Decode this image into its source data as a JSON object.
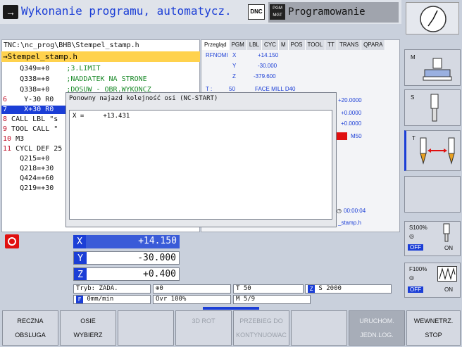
{
  "header": {
    "mode_title": "Wykonanie programu, automatycz.",
    "dnc_icon": "DNC",
    "pgm_icon_line1": "PGM",
    "pgm_icon_line2": "MGT",
    "programming_label": "Programowanie"
  },
  "program": {
    "path": "TNC:\\nc_prog\\BHB\\Stempel_stamp.h",
    "file": "→Stempel_stamp.h",
    "lines": [
      {
        "num": "",
        "code": "    Q349=+0",
        "comment": "    ;3.LIMIT"
      },
      {
        "num": "",
        "code": "    Q338=+0",
        "comment": "    ;NADDATEK NA STRONE"
      },
      {
        "num": "",
        "code": "    Q338=+0",
        "comment": "    ;DOSUW - OBR.WYKONCZ"
      },
      {
        "num": "6",
        "code": "    Y-30 R0",
        "comment": ""
      },
      {
        "num": "7",
        "code": "    X+30 R0",
        "comment": ""
      },
      {
        "num": "8",
        "code": " CALL LBL \"s",
        "comment": ""
      },
      {
        "num": "9",
        "code": " TOOL CALL \"",
        "comment": ""
      },
      {
        "num": "10",
        "code": " M3",
        "comment": ""
      },
      {
        "num": "11",
        "code": " CYCL DEF 25",
        "comment": ""
      },
      {
        "num": "",
        "code": "    Q215=+0",
        "comment": ""
      },
      {
        "num": "",
        "code": "    Q218=+30",
        "comment": ""
      },
      {
        "num": "",
        "code": "    Q424=+60",
        "comment": ""
      },
      {
        "num": "",
        "code": "    Q219=+30",
        "comment": ""
      }
    ]
  },
  "status": {
    "tabs": [
      "Przegląd",
      "PGM",
      "LBL",
      "CYC",
      "M",
      "POS",
      "TOOL",
      "TT",
      "TRANS",
      "QPARA"
    ],
    "rfnomi": "RFNOMI",
    "axes": [
      {
        "axis": "X",
        "value": "+14.150"
      },
      {
        "axis": "Y",
        "value": "-30.000"
      },
      {
        "axis": "Z",
        "value": "-379.600"
      }
    ],
    "tool_label": "T :",
    "tool_num": "50",
    "tool_name": "FACE MILL D40",
    "val1": "+20.0000",
    "val2": "+0.0000",
    "val3": "+0.0000",
    "mfunc": "M50",
    "time": "00:00:04",
    "file_short": "_stamp.h"
  },
  "dialog": {
    "title": "Ponowny najazd kolejność osi (NC-START)",
    "line": "X =     +13.431"
  },
  "position": {
    "axes": [
      {
        "axis": "X",
        "value": "+14.150"
      },
      {
        "axis": "Y",
        "value": "-30.000"
      },
      {
        "axis": "Z",
        "value": "+0.400"
      }
    ],
    "mode": "Tryb: ZADA.",
    "rot": "0",
    "tool": "T 50",
    "spindle_axis": "Z",
    "spindle": "S 2000",
    "feed": "0mm/min",
    "ovr": "Ovr 100%",
    "m_label": "M",
    "m_val": "5/9",
    "feed_label": "F"
  },
  "right_keys": {
    "m": "M",
    "s": "S",
    "t": "T",
    "s100": "S100%",
    "f100": "F100%",
    "off": "OFF",
    "on": "ON"
  },
  "softkeys": [
    {
      "l1": "RECZNA",
      "l2": "OBSLUGA",
      "state": "enabled"
    },
    {
      "l1": "OSIE",
      "l2": "WYBIERZ",
      "state": "enabled"
    },
    {
      "l1": "",
      "l2": "",
      "state": "enabled"
    },
    {
      "l1": "3D ROT",
      "l2": "",
      "state": "disabled"
    },
    {
      "l1": "PRZEBIEG DO",
      "l2": "KONTYNUOWAC",
      "state": "disabled"
    },
    {
      "l1": "",
      "l2": "",
      "state": "enabled"
    },
    {
      "l1": "URUCHOM.",
      "l2": "JEDN.LOG.",
      "state": "dark"
    },
    {
      "l1": "WEWNETRZ.",
      "l2": "STOP",
      "state": "enabled"
    }
  ],
  "colors": {
    "accent": "#1b3ed6",
    "highlight": "#ffd24d",
    "alert": "#e01010"
  }
}
